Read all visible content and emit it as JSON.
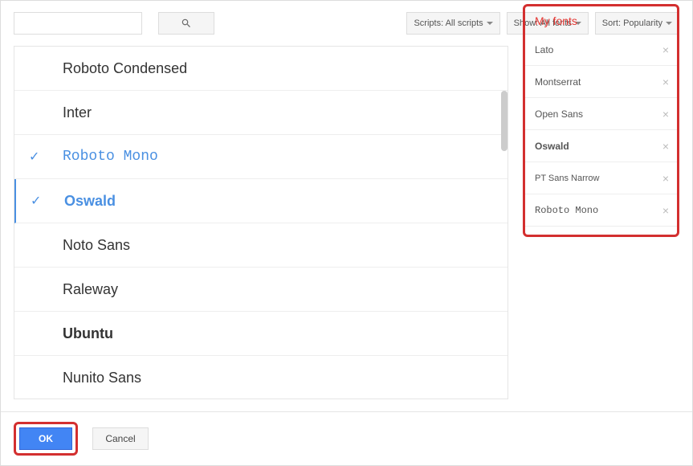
{
  "filters": {
    "scripts": "Scripts: All scripts",
    "show": "Show: All fonts",
    "sort": "Sort: Popularity"
  },
  "search": {
    "value": ""
  },
  "fontList": [
    {
      "name": "Roboto Condensed",
      "selected": false,
      "style": "ff-condensed"
    },
    {
      "name": "Inter",
      "selected": false,
      "style": "ff-sans"
    },
    {
      "name": "Roboto Mono",
      "selected": true,
      "style": "ff-mono"
    },
    {
      "name": "Oswald",
      "selected": true,
      "style": "ff-bold",
      "activeLeft": true
    },
    {
      "name": "Noto Sans",
      "selected": false,
      "style": "ff-sans"
    },
    {
      "name": "Raleway",
      "selected": false,
      "style": "ff-thin"
    },
    {
      "name": "Ubuntu",
      "selected": false,
      "style": "ff-bold"
    },
    {
      "name": "Nunito Sans",
      "selected": false,
      "style": "ff-sans"
    }
  ],
  "myFonts": {
    "title": "My fonts",
    "items": [
      {
        "name": "Lato",
        "cls": ""
      },
      {
        "name": "Montserrat",
        "cls": ""
      },
      {
        "name": "Open Sans",
        "cls": ""
      },
      {
        "name": "Oswald",
        "cls": "mf-bold"
      },
      {
        "name": "PT Sans Narrow",
        "cls": "mf-narrow"
      },
      {
        "name": "Roboto Mono",
        "cls": "mf-mono"
      }
    ]
  },
  "buttons": {
    "ok": "OK",
    "cancel": "Cancel"
  }
}
